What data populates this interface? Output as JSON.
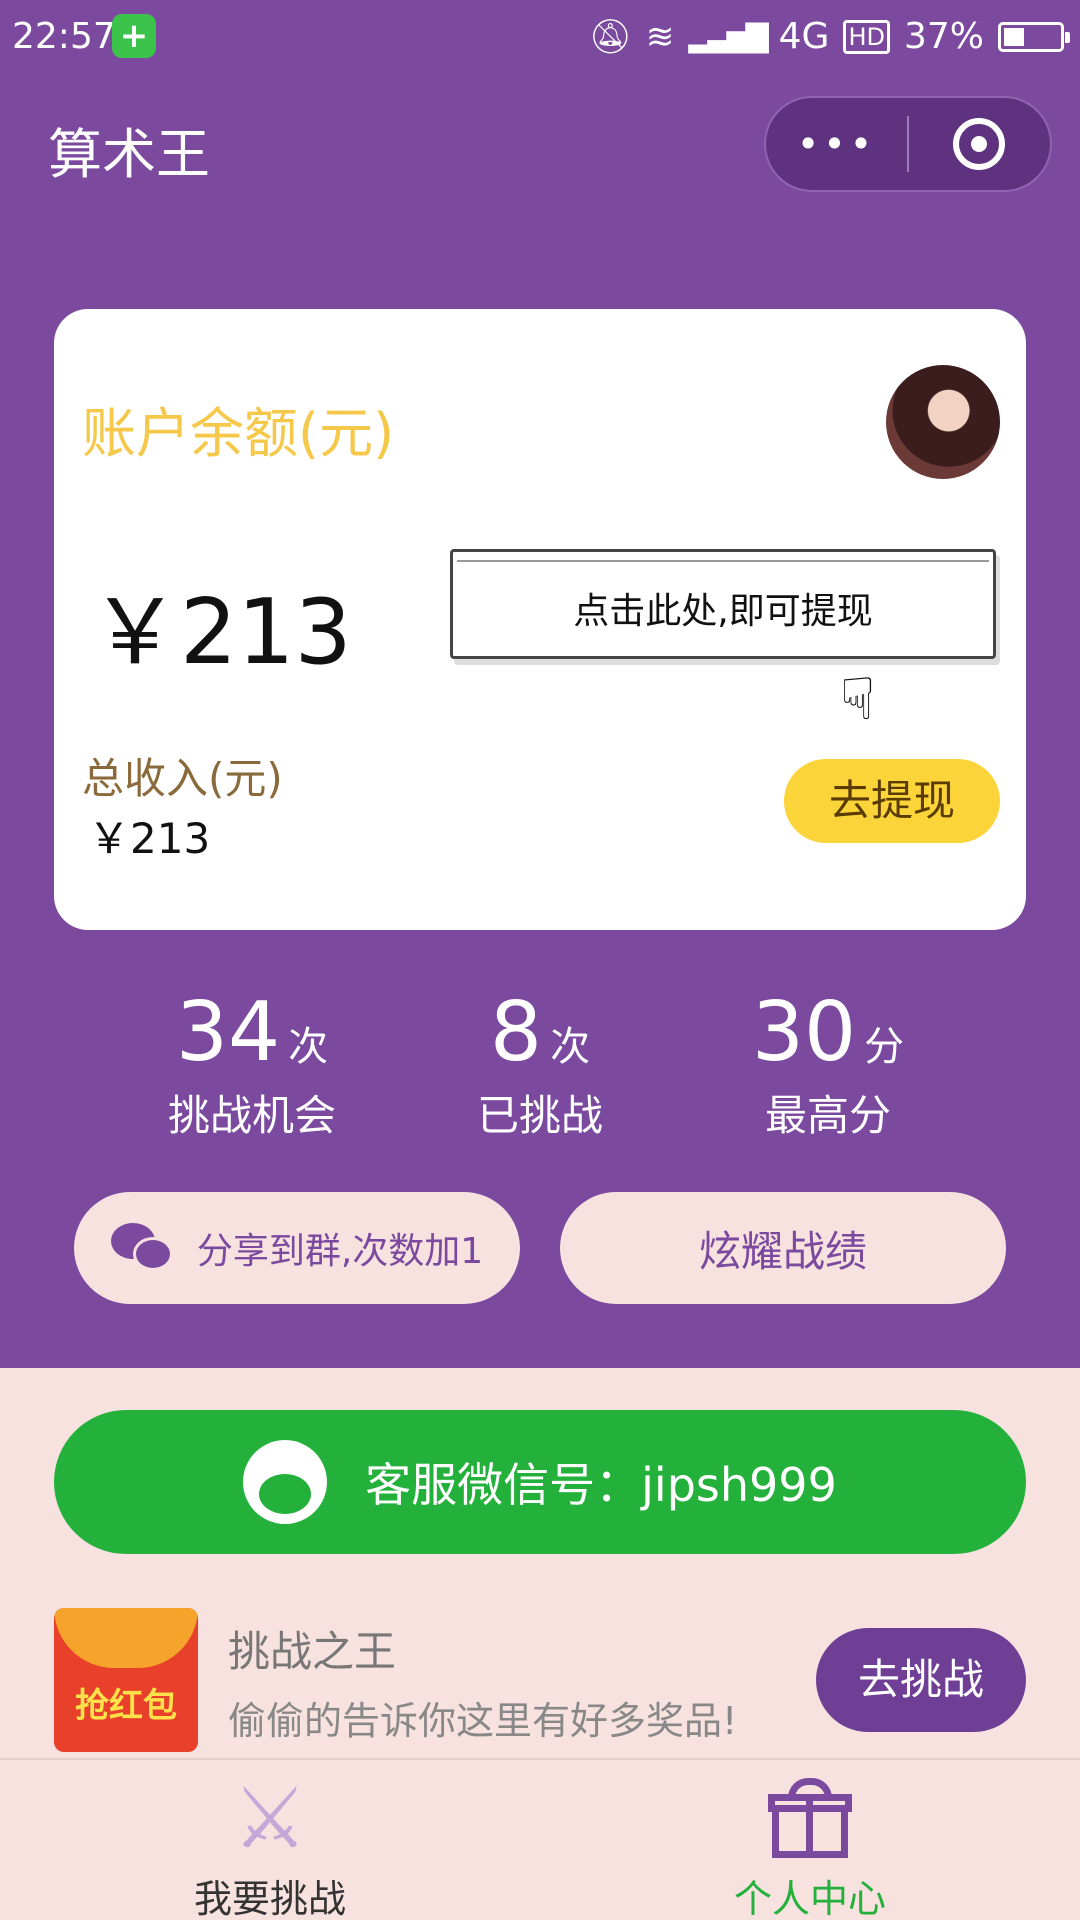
{
  "status_bar": {
    "time": "22:57",
    "network": "4G",
    "hd": "HD",
    "battery": "37%",
    "battery_level": 0.37
  },
  "nav": {
    "title": "算术王",
    "more_icon": "more-dots-icon",
    "close_icon": "target-icon"
  },
  "account": {
    "balance_label": "账户余额(元)",
    "balance": "￥213",
    "withdraw_tip": "点击此处,即可提现",
    "total_income_label": "总收入(元)",
    "total_income": "￥213",
    "withdraw_button": "去提现"
  },
  "stats": [
    {
      "value": "34",
      "unit": "次",
      "label": "挑战机会"
    },
    {
      "value": "8",
      "unit": "次",
      "label": "已挑战"
    },
    {
      "value": "30",
      "unit": "分",
      "label": "最高分"
    }
  ],
  "actions": {
    "share": "分享到群,次数加1",
    "show_off": "炫耀战绩"
  },
  "service": {
    "text": "客服微信号：jipsh999"
  },
  "promo": {
    "icon_text": "抢红包",
    "title": "挑战之王",
    "subtitle": "偷偷的告诉你这里有好多奖品!",
    "button": "去挑战"
  },
  "tabbar": {
    "tabs": [
      {
        "label": "我要挑战",
        "icon": "crossed-swords-icon",
        "color": "#333333"
      },
      {
        "label": "个人中心",
        "icon": "gift-icon",
        "color": "#23b03b",
        "active": true
      }
    ]
  },
  "colors": {
    "primary": "#7b4a9f",
    "accent_yellow": "#fbd43a",
    "green": "#23b03b",
    "background": "#f7e2df"
  }
}
